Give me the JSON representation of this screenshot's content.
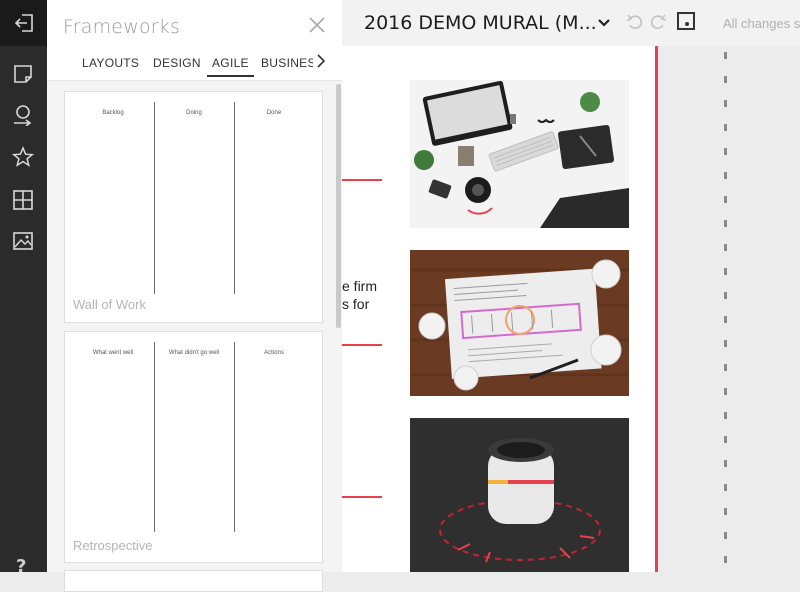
{
  "rail": {
    "icons": [
      "exit-icon",
      "sticky-note-icon",
      "comment-icon",
      "star-icon",
      "grid-icon",
      "image-icon"
    ],
    "help_label": "?"
  },
  "panel": {
    "title": "Frameworks",
    "tabs": [
      {
        "label": "LAYOUTS",
        "active": false
      },
      {
        "label": "DESIGN",
        "active": false
      },
      {
        "label": "AGILE",
        "active": true
      },
      {
        "label": "BUSINESS",
        "active": false
      }
    ],
    "cards": [
      {
        "name": "Wall of Work",
        "columns": [
          "Backlog",
          "Doing",
          "Done"
        ]
      },
      {
        "name": "Retrospective",
        "columns": [
          "What went well",
          "What didn't go well",
          "Actions"
        ]
      }
    ]
  },
  "topbar": {
    "mural_title": "2016 DEMO MURAL (M...",
    "status": "All changes s"
  },
  "canvas": {
    "snippet_line1": "e firm",
    "snippet_line2": "s for"
  },
  "colors": {
    "accent_red": "#e8404d",
    "rail_bg": "#2b2b2b",
    "panel_bg": "#ffffff"
  }
}
